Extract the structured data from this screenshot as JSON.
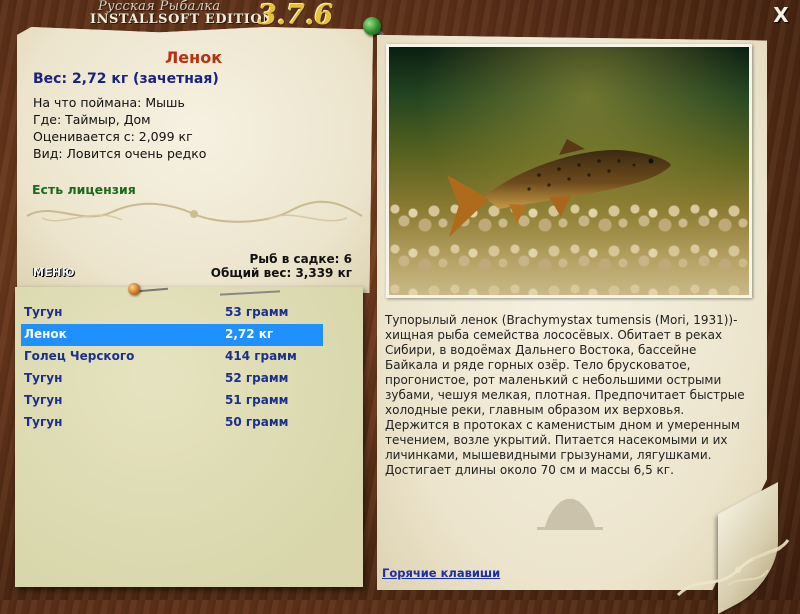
{
  "window": {
    "title_line1": "Русская Рыбалка",
    "title_line2": "INSTALLSOFT EDITION",
    "version": "3.7.6",
    "close_label": "X"
  },
  "fish_card": {
    "name": "Ленок",
    "weight_line": "Вес: 2,72 кг (зачетная)",
    "info_lines": [
      "На что поймана: Мышь",
      "Где: Таймыр, Дом",
      "Оценивается с: 2,099 кг",
      "Вид: Ловится очень редко"
    ],
    "license": "Есть лицензия"
  },
  "cage": {
    "count_line": "Рыб в садке: 6",
    "total_line": "Общий вес: 3,339 кг"
  },
  "menu_button": "МЕНЮ",
  "catch_list": [
    {
      "name": "Тугун",
      "weight": "53 грамм",
      "selected": false
    },
    {
      "name": "Ленок",
      "weight": "2,72 кг",
      "selected": true
    },
    {
      "name": "Голец Черского",
      "weight": "414 грамм",
      "selected": false
    },
    {
      "name": "Тугун",
      "weight": "52 грамм",
      "selected": false
    },
    {
      "name": "Тугун",
      "weight": "51 грамм",
      "selected": false
    },
    {
      "name": "Тугун",
      "weight": "50 грамм",
      "selected": false
    }
  ],
  "description": "Тупорылый ленок (Brachymystax tumensis (Mori, 1931))- хищная рыба семейства лососёвых. Обитает в реках Сибири, в водоёмах Дальнего Востока, бассейне Байкала и ряде горных озёр. Тело брусковатое, прогонистое, рот маленький с небольшими острыми зубами, чешуя мелкая, плотная. Предпочитает быстрые холодные реки, главным образом их верховья. Держится в протоках с каменистым дном и умеренным течением, возле укрытий. Питается насекомыми и их личинками, мышевидными грызунами, лягушками. Достигает длины около 70 см и массы 6,5 кг.",
  "hotkeys_link": "Горячие клавиши",
  "colors": {
    "selected_row": "#1e90ff",
    "list_text": "#1b2f8c",
    "fish_name": "#b8300d",
    "weight": "#1a237e",
    "license": "#1a6a1a",
    "version": "#e6c23a"
  }
}
